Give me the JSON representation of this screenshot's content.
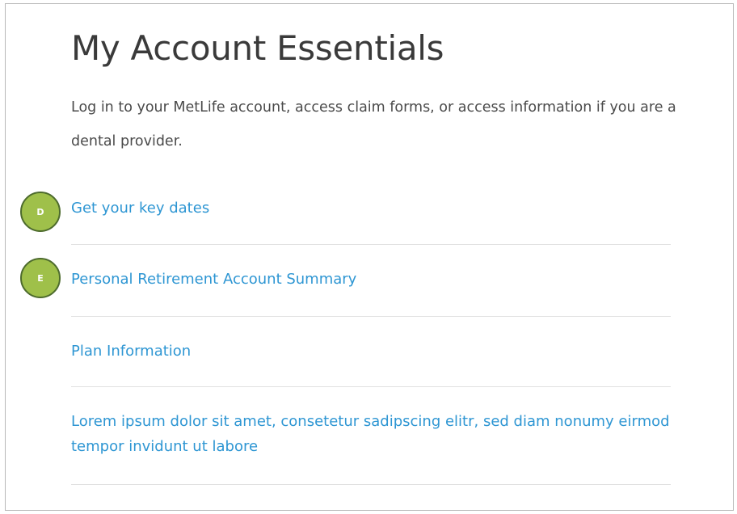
{
  "title": "My Account Essentials",
  "description": "Log in to your MetLife account, access claim forms, or access information if you are a dental provider.",
  "links": [
    {
      "label": "Get your key dates"
    },
    {
      "label": "Personal Retirement Account Summary"
    },
    {
      "label": "Plan Information"
    },
    {
      "label": "Lorem ipsum dolor sit amet, consetetur sadipscing elitr, sed diam nonumy eirmod tempor invidunt ut labore"
    }
  ],
  "markers": [
    {
      "label": "D"
    },
    {
      "label": "E"
    }
  ],
  "colors": {
    "link": "#2e96d3",
    "marker_fill": "#9fc04a",
    "marker_border": "#4d6b2d",
    "divider": "#e1e1e1"
  }
}
